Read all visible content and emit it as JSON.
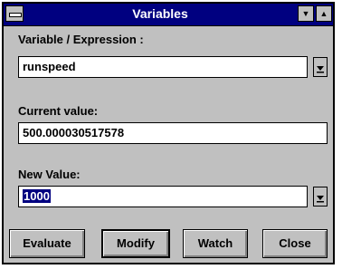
{
  "window": {
    "title": "Variables"
  },
  "variable": {
    "label": "Variable / Expression :",
    "value": "runspeed"
  },
  "current": {
    "label": "Current value:",
    "value": "500.000030517578"
  },
  "new_value": {
    "label": "New Value:",
    "value": "1000"
  },
  "buttons": {
    "evaluate": "Evaluate",
    "modify": "Modify",
    "watch": "Watch",
    "close": "Close"
  }
}
